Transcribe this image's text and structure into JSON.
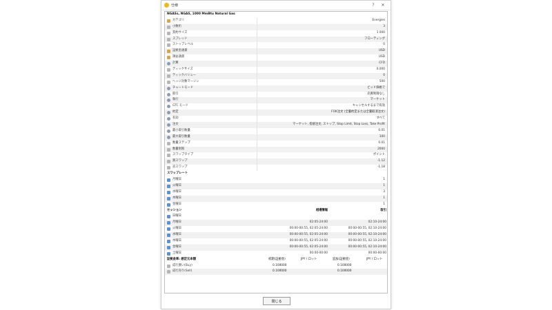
{
  "window": {
    "title": "仕様",
    "help_glyph": "?",
    "close_glyph": "✕"
  },
  "symbol_title": "NGASs, NGAS, 1000 MmBtu Natural Gas",
  "specs": [
    {
      "label": "カテゴリ",
      "value": "Energies",
      "icon": "flag"
    },
    {
      "label": "小数桁",
      "value": "3",
      "icon": "pct"
    },
    {
      "label": "契約サイズ",
      "value": "1 000",
      "icon": "pct"
    },
    {
      "label": "スプレッド",
      "value": "フローティング",
      "icon": "pct"
    },
    {
      "label": "ストップレベル",
      "value": "0",
      "icon": "pct"
    },
    {
      "label": "証拠金通貨",
      "value": "USD",
      "icon": "flag"
    },
    {
      "label": "損益通貨",
      "value": "USD",
      "icon": "flag"
    },
    {
      "label": "計算",
      "value": "CFD",
      "icon": "gear"
    },
    {
      "label": "ティックサイズ",
      "value": "0.000",
      "icon": "pct"
    },
    {
      "label": "ティックバリュー",
      "value": "0",
      "icon": "pct"
    },
    {
      "label": "ヘッジ対象マージン",
      "value": "500",
      "icon": "pct"
    },
    {
      "label": "チャートモード",
      "value": "ビッド価格で",
      "icon": "gear"
    },
    {
      "label": "取引",
      "value": "売買制限なし",
      "icon": "gear"
    },
    {
      "label": "執行",
      "value": "マーケット",
      "icon": "gear"
    },
    {
      "label": "GTC モード",
      "value": "キャンセルするまで有効",
      "icon": "gear"
    },
    {
      "label": "約定",
      "value": "FOK注文 (全量約定または全量取消注文)",
      "icon": "gear"
    },
    {
      "label": "有効",
      "value": "すべて",
      "icon": "gear"
    },
    {
      "label": "注文",
      "value": "マーケット, 指値注文, ストップ, Stop Limit, Stop Loss, Take Profit",
      "icon": "gear"
    },
    {
      "label": "最小取引数量",
      "value": "0.01",
      "icon": "gear"
    },
    {
      "label": "最大取引数量",
      "value": "100",
      "icon": "gear"
    },
    {
      "label": "数量ステップ",
      "value": "0.01",
      "icon": "pct"
    },
    {
      "label": "数量制限",
      "value": "2000",
      "icon": "pct"
    },
    {
      "label": "スワップタイプ",
      "value": "ポイント",
      "icon": "pct"
    },
    {
      "label": "買スワップ",
      "value": "-1.12",
      "icon": "pct"
    },
    {
      "label": "売スワップ",
      "value": "-1.18",
      "icon": "pct"
    }
  ],
  "swap_rates": {
    "heading": "スワップレート",
    "rows": [
      {
        "day": "月曜日",
        "value": "1"
      },
      {
        "day": "火曜日",
        "value": "1"
      },
      {
        "day": "水曜日",
        "value": "3"
      },
      {
        "day": "木曜日",
        "value": "1"
      },
      {
        "day": "金曜日",
        "value": "1"
      }
    ]
  },
  "sessions": {
    "heading": "セッション",
    "col_quotes": "相場情報",
    "col_trade": "取引",
    "rows": [
      {
        "day": "日曜日",
        "quotes": "",
        "trade": ""
      },
      {
        "day": "月曜日",
        "quotes": "02:05-24:00",
        "trade": "02:10-24:00"
      },
      {
        "day": "火曜日",
        "quotes": "00:00-00:55, 02:05-24:00",
        "trade": "00:00-00:55, 02:10-24:00"
      },
      {
        "day": "水曜日",
        "quotes": "00:00-00:55, 02:05-24:00",
        "trade": "00:00-00:55, 02:10-24:00"
      },
      {
        "day": "木曜日",
        "quotes": "00:00-00:55, 02:05-24:00",
        "trade": "00:00-00:55, 02:10-24:00"
      },
      {
        "day": "金曜日",
        "quotes": "00:00-00:55, 02:05-24:00",
        "trade": "00:00-00:55, 02:10-24:00"
      },
      {
        "day": "土曜日",
        "quotes": "00:00-00:00",
        "trade": "00:00-00:00"
      }
    ]
  },
  "margin": {
    "heading": "証拠金率: 想定元本額",
    "col_initial": "初期(証拠金)",
    "col_unit1": "JPY / ロット",
    "col_maint": "追加(証拠金)",
    "col_unit2": "JPY / ロット",
    "rows": [
      {
        "label": "成行買い(Buy)",
        "initial": "0.100000",
        "maint": "0.100000"
      },
      {
        "label": "成行売り(Sell)",
        "initial": "0.100000",
        "maint": "0.100000"
      }
    ]
  },
  "footer": {
    "close_label": "閉じる"
  },
  "colors": {
    "accent_logo": "#f2b61c",
    "row_alt": "#f1f1f1",
    "calendar_icon": "#5b8fd6"
  }
}
